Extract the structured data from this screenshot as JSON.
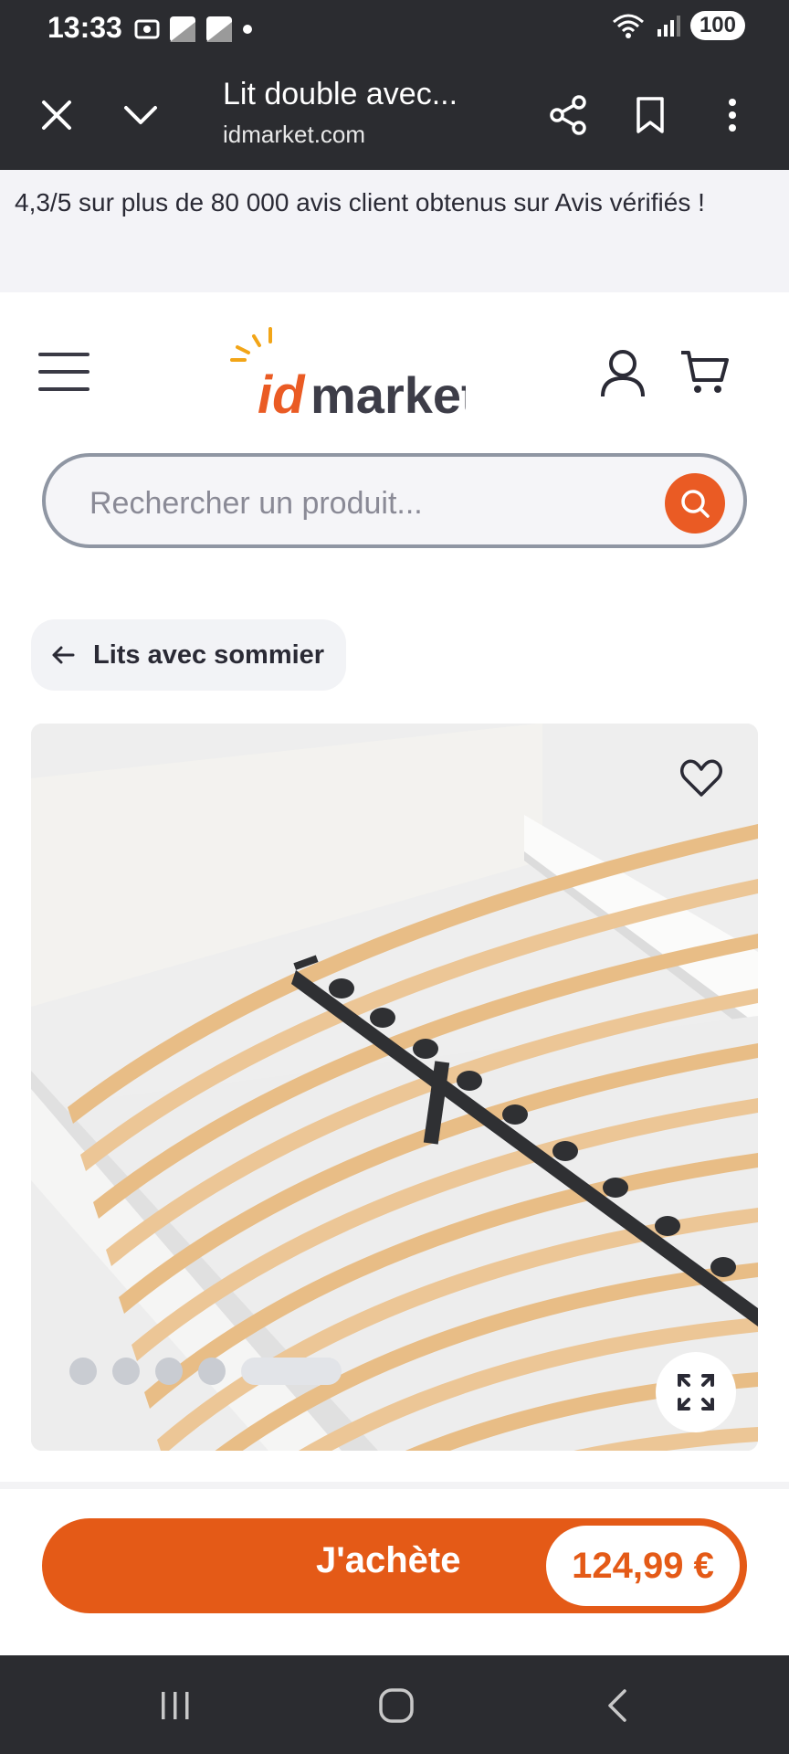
{
  "status_bar": {
    "time": "13:33",
    "battery": "100"
  },
  "browser": {
    "title": "Lit double avec...",
    "url": "idmarket.com"
  },
  "banner": {
    "text": "4,3/5 sur plus de 80 000 avis client obtenus sur Avis vérifiés !"
  },
  "header": {
    "logo_id": "id",
    "logo_market": "market"
  },
  "search": {
    "placeholder": "Rechercher un produit..."
  },
  "breadcrumb": {
    "label": "Lits avec sommier"
  },
  "gallery": {
    "image_count": 5,
    "active_index": 4
  },
  "cta": {
    "label": "J'achète",
    "price": "124,99 €"
  },
  "colors": {
    "accent": "#E45A17",
    "dark_bar": "#2B2C30",
    "banner_bg": "#F3F3F7"
  }
}
